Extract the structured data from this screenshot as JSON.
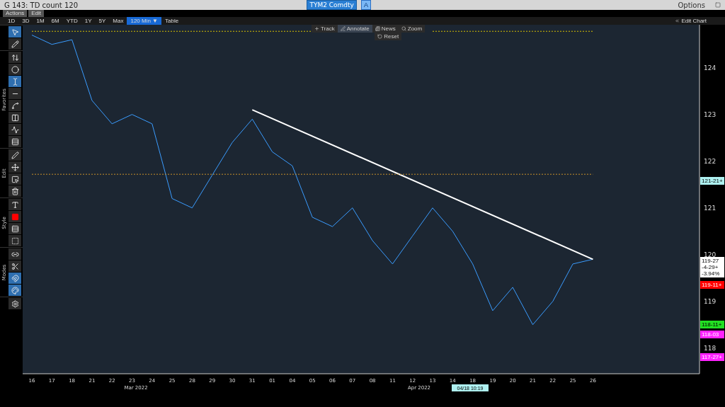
{
  "window": {
    "title": "G 143: TD count 120",
    "ticker": "TYM2 Comdty",
    "ticker_button": "A",
    "options": "Options"
  },
  "menu": [
    "Actions",
    "Edit"
  ],
  "ranges": [
    {
      "label": "1D",
      "selected": false
    },
    {
      "label": "3D",
      "selected": false
    },
    {
      "label": "1M",
      "selected": false
    },
    {
      "label": "6M",
      "selected": false
    },
    {
      "label": "YTD",
      "selected": false
    },
    {
      "label": "1Y",
      "selected": false
    },
    {
      "label": "5Y",
      "selected": false
    },
    {
      "label": "Max",
      "selected": false
    },
    {
      "label": "120 Min ▼",
      "selected": true
    },
    {
      "label": "Table",
      "selected": false
    }
  ],
  "edit_chart": "Edit Chart",
  "chart_tools": [
    {
      "kind": "track",
      "label": "Track",
      "selected": false
    },
    {
      "kind": "annotate",
      "label": "Annotate",
      "selected": true
    },
    {
      "kind": "news",
      "label": "News",
      "selected": false
    },
    {
      "kind": "zoom",
      "label": "Zoom",
      "selected": false
    }
  ],
  "reset": "Reset",
  "sidebar": {
    "groups": [
      {
        "tools": [
          {
            "kind": "pointer",
            "selected": true
          },
          {
            "kind": "pencil",
            "selected": false
          }
        ]
      },
      {
        "label": "Favorites",
        "tools": [
          {
            "kind": "fib",
            "selected": false
          },
          {
            "kind": "ellipse",
            "selected": false
          },
          {
            "kind": "text",
            "selected": true
          },
          {
            "kind": "hline",
            "selected": false
          },
          {
            "kind": "segment",
            "selected": false
          },
          {
            "kind": "channel",
            "selected": false
          },
          {
            "kind": "polyline",
            "selected": false
          },
          {
            "kind": "pitchfork",
            "selected": false
          }
        ]
      },
      {
        "label": "Edit",
        "tools": [
          {
            "kind": "pen",
            "selected": false
          },
          {
            "kind": "move",
            "selected": false
          },
          {
            "kind": "select",
            "selected": false
          },
          {
            "kind": "trash",
            "selected": false
          }
        ]
      },
      {
        "label": "Style",
        "tools": [
          {
            "kind": "font",
            "selected": false
          },
          {
            "kind": "color",
            "selected": false
          },
          {
            "kind": "thickness",
            "selected": false
          },
          {
            "kind": "dash",
            "selected": false
          }
        ]
      },
      {
        "label": "Modes",
        "tools": [
          {
            "kind": "link",
            "selected": false
          },
          {
            "kind": "snap",
            "selected": false
          },
          {
            "kind": "magnet",
            "selected": true
          },
          {
            "kind": "colors",
            "selected": true
          }
        ]
      },
      {
        "tools": [
          {
            "kind": "gear",
            "selected": false
          }
        ]
      }
    ]
  },
  "chart": {
    "chart_data": {
      "type": "line",
      "categories": [
        "16",
        "17",
        "18",
        "21",
        "22",
        "23",
        "24",
        "25",
        "28",
        "29",
        "30",
        "31",
        "01",
        "04",
        "05",
        "06",
        "07",
        "08",
        "11",
        "12",
        "13",
        "14",
        "18",
        "19",
        "20",
        "21",
        "22",
        "25",
        "26"
      ],
      "series": [
        {
          "color": "#3a9cff",
          "values": [
            124.7,
            124.5,
            124.6,
            123.3,
            122.8,
            123.0,
            122.8,
            121.2,
            121.0,
            121.7,
            122.4,
            122.9,
            122.2,
            121.9,
            120.8,
            120.6,
            121.0,
            120.3,
            119.8,
            120.4,
            121.0,
            120.5,
            119.8,
            118.8,
            119.3,
            118.5,
            119.0,
            119.8,
            119.9
          ]
        },
        {
          "color": "#ffffff",
          "values": [
            null,
            null,
            null,
            null,
            null,
            null,
            null,
            null,
            null,
            null,
            null,
            123.1,
            null,
            null,
            null,
            null,
            null,
            null,
            null,
            null,
            null,
            null,
            null,
            null,
            null,
            null,
            null,
            null,
            119.9
          ]
        },
        {
          "color": "#d8c000",
          "line_style": "dashed",
          "values": [
            124.78,
            124.78,
            124.78,
            124.78,
            124.78,
            124.78,
            124.78,
            124.78,
            124.78,
            124.78,
            124.78,
            124.78,
            124.78,
            124.78,
            124.78,
            null,
            null,
            null,
            null,
            null,
            124.78,
            124.78,
            124.78,
            124.78,
            124.78,
            124.78,
            124.78,
            124.78,
            124.78
          ]
        },
        {
          "color": "#c8902a",
          "line_style": "dashed",
          "values": [
            121.72,
            121.72,
            121.72,
            121.72,
            121.72,
            121.72,
            121.72,
            121.72,
            121.72,
            121.72,
            121.72,
            121.72,
            121.72,
            121.72,
            121.72,
            121.72,
            121.72,
            121.72,
            121.72,
            121.72,
            121.72,
            121.72,
            121.72,
            121.72,
            121.72,
            121.72,
            121.72,
            121.72,
            121.72
          ]
        }
      ],
      "yticks": [
        {
          "value": 118,
          "label": "118"
        },
        {
          "value": 119,
          "label": "119"
        },
        {
          "value": 120,
          "label": "120"
        },
        {
          "value": 121,
          "label": "121"
        },
        {
          "value": 122,
          "label": "122"
        },
        {
          "value": 123,
          "label": "123"
        },
        {
          "value": 124,
          "label": "124"
        }
      ],
      "ylim": [
        117.45,
        124.92
      ]
    },
    "months": [
      "Mar 2022",
      "Apr 2022"
    ],
    "cursor_label": "04/18 10:19",
    "price_tags": [
      {
        "lines": [
          "121-21+"
        ],
        "color": "#aef0f0"
      },
      {
        "lines": [
          "119-27",
          "-4-29+",
          "-3.94%"
        ],
        "color": "#ffffff"
      },
      {
        "lines": [
          "119-11+"
        ],
        "color": "#ff0000"
      },
      {
        "lines": [
          "118-11+"
        ],
        "color": "#22e022"
      },
      {
        "lines": [
          "118-03"
        ],
        "color": "#ff22ff"
      },
      {
        "lines": [
          "117-27+"
        ],
        "color": "#ff22ff"
      }
    ]
  }
}
